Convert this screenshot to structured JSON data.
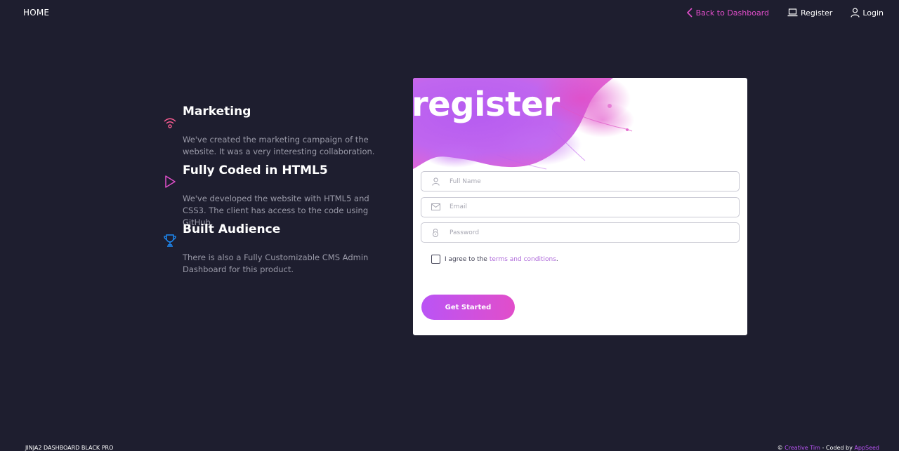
{
  "nav": {
    "brand": "HOME",
    "back_label": "Back to Dashboard",
    "register_label": "Register",
    "login_label": "Login",
    "accent_color": "#e14eca"
  },
  "features": [
    {
      "icon": "wifi-icon",
      "title": "Marketing",
      "description": "We've created the marketing campaign of the website. It was a very interesting collaboration."
    },
    {
      "icon": "play-icon",
      "title": "Fully Coded in HTML5",
      "description": "We've developed the website with HTML5 and CSS3. The client has access to the code using GitHub."
    },
    {
      "icon": "trophy-icon",
      "title": "Built Audience",
      "description": "There is also a Fully Customizable CMS Admin Dashboard for this product."
    }
  ],
  "card": {
    "title": "register",
    "fields": {
      "full_name_placeholder": "Full Name",
      "email_placeholder": "Email",
      "password_placeholder": "Password"
    },
    "agree_text": "I agree to the",
    "terms_link": "terms and conditions",
    "terms_suffix": ".",
    "submit_label": "Get Started",
    "button_gradient": [
      "#ba54f5",
      "#e14eca"
    ]
  },
  "footer": {
    "left_text": "JINJA2 DASHBOARD BLACK PRO",
    "copyright": "©",
    "creative_link": "Creative Tim",
    "coded_by": "- Coded by",
    "appseed_link": "AppSeed"
  }
}
